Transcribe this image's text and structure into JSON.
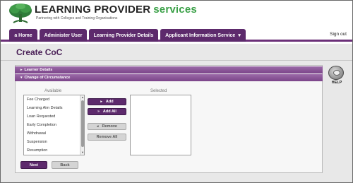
{
  "brand": {
    "name_part1": "LEARNING PROVIDER",
    "name_part2": "services",
    "tagline": "Partnering with Colleges and Training Organisations"
  },
  "nav": {
    "tabs": [
      "a Home",
      "Administer User",
      "Learning Provider Details",
      "Applicant Information Service"
    ],
    "dropdown_glyph": "▾",
    "signout": "Sign out"
  },
  "page": {
    "title": "Create CoC"
  },
  "accordion": {
    "learner_details": "Learner Details",
    "change_of_circumstance": "Change of Circumstance",
    "collapsed_arrow": "▸",
    "expanded_arrow": "▾"
  },
  "transfer": {
    "available_label": "Available",
    "selected_label": "Selected",
    "available_items": [
      "Fee Charged",
      "Learning Aim Details",
      "Loan Requested",
      "Early Completion",
      "Withdrawal",
      "Suspension",
      "Resumption"
    ],
    "selected_items": [],
    "add": "Add",
    "add_all": "Add All",
    "remove": "Remove",
    "remove_all": "Remove All"
  },
  "footer_buttons": {
    "next": "Next",
    "back": "Back"
  },
  "help": {
    "label": "HELP"
  },
  "colors": {
    "brand_purple": "#5d2a6c",
    "brand_green": "#3aa047",
    "accordion_purple": "#8a55a0"
  }
}
